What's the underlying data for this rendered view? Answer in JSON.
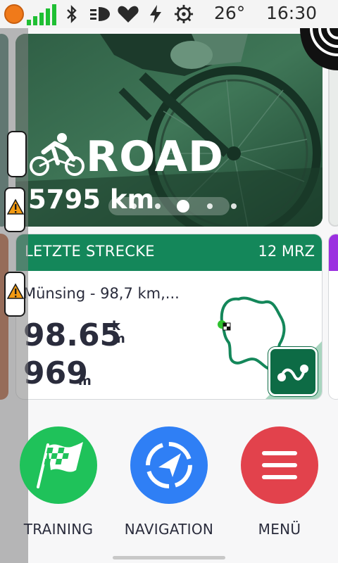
{
  "status_bar": {
    "temperature": "26°",
    "time": "16:30",
    "icons": [
      "orange-dot-icon",
      "signal-bars-icon",
      "bluetooth-icon",
      "headlight-icon",
      "heart-icon",
      "bolt-icon",
      "gear-icon"
    ]
  },
  "hero": {
    "sport": "ROAD",
    "distance": "5795 km",
    "page_count": 5,
    "active_page": 3
  },
  "last_route": {
    "header": "LETZTE STRECKE",
    "date": "12 MRZ",
    "name": "Münsing - 98,7 km,...",
    "distance_value": "98.65",
    "distance_unit_top": "k",
    "distance_unit_bottom": "m",
    "elevation_value": "969",
    "elevation_unit": "m"
  },
  "actions": [
    {
      "label": "TRAINING",
      "color": "#1fc25a",
      "icon": "checkered-flag-icon"
    },
    {
      "label": "NAVIGATION",
      "color": "#2f7ff5",
      "icon": "compass-arrow-icon"
    },
    {
      "label": "MENÜ",
      "color": "#e2424c",
      "icon": "hamburger-menu-icon"
    }
  ],
  "colors": {
    "route_header": "#14875a",
    "route_button": "#0d6b45",
    "next_card_header": "#9b30e0",
    "prev_card": "#b2542c"
  }
}
